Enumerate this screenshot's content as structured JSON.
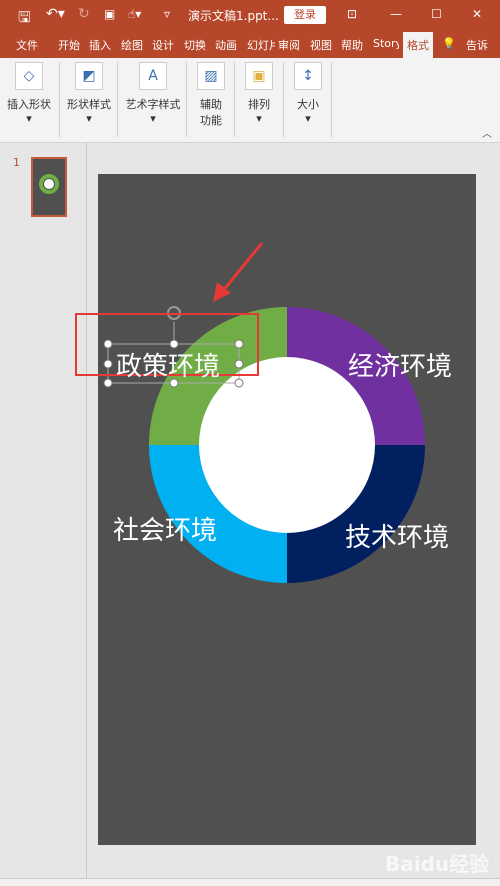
{
  "titlebar": {
    "title": "演示文稿1.ppt...",
    "login": "登录",
    "icons": [
      "save-icon",
      "undo-icon",
      "redo-icon",
      "present-icon",
      "touch-icon",
      "customize-icon",
      "ribbon-display-icon",
      "minimize-icon",
      "maximize-icon",
      "close-icon"
    ]
  },
  "tabs": [
    "文件",
    "开始",
    "插入",
    "绘图",
    "设计",
    "切换",
    "动画",
    "幻灯片",
    "审阅",
    "视图",
    "帮助",
    "Story",
    "格式",
    "告诉"
  ],
  "ribbon": {
    "groups": [
      {
        "label": "插入形状"
      },
      {
        "label": "形状样式"
      },
      {
        "label": "艺术字样式"
      },
      {
        "label": "辅助功能"
      },
      {
        "label": "排列"
      },
      {
        "label": "大小"
      }
    ]
  },
  "thumbnail": {
    "number": "1"
  },
  "slide": {
    "background": "#505050",
    "labels": {
      "policy": "政策环境",
      "economy": "经济环境",
      "society": "社会环境",
      "tech": "技术环境"
    },
    "colors": {
      "policy": "#70ad47",
      "economy": "#7030a0",
      "society": "#00b0f0",
      "tech": "#002060"
    }
  },
  "watermark": "Baidu经验"
}
